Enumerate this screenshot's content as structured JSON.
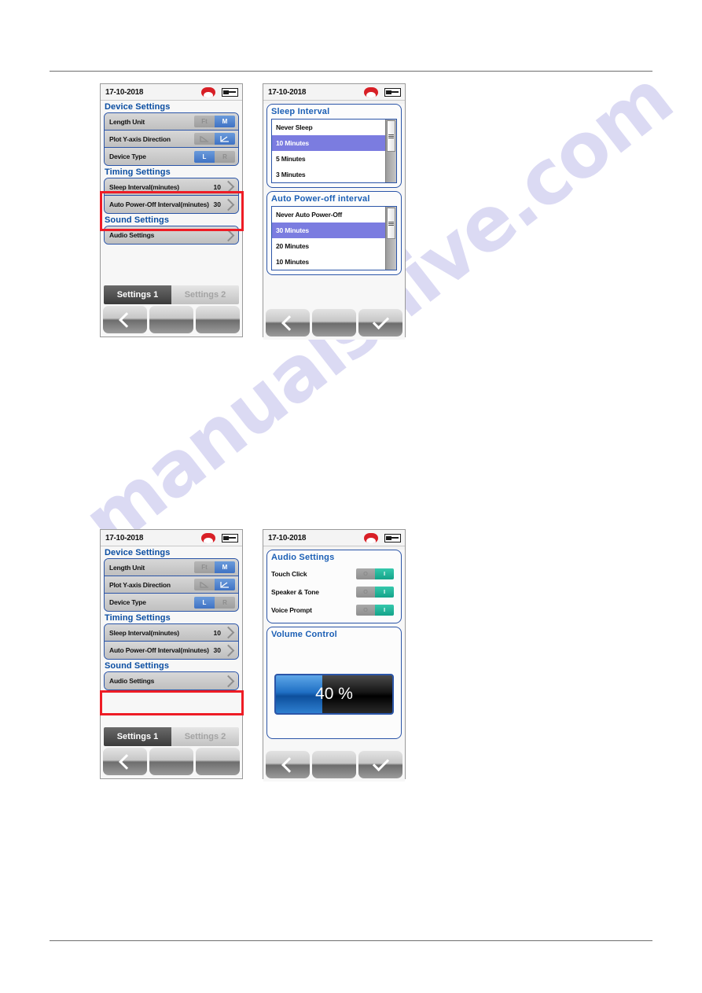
{
  "page": {
    "watermark_text": "manualshive.com"
  },
  "status_bar": {
    "date": "17-10-2018",
    "end_call_icon": "end-call-icon",
    "battery_icon": "battery-icon"
  },
  "screens": {
    "settings_list": {
      "sections": [
        {
          "title": "Device Settings",
          "rows": [
            {
              "label": "Length Unit",
              "type": "segmented",
              "options": [
                "Ft",
                "M"
              ],
              "selected_index": 1
            },
            {
              "label": "Plot Y-axis Direction",
              "type": "segmented",
              "options": [
                "down-plot-icon",
                "up-plot-icon"
              ],
              "selected_index": 1
            },
            {
              "label": "Device Type",
              "type": "segmented",
              "options": [
                "L",
                "R"
              ],
              "selected_index": 0
            }
          ]
        },
        {
          "title": "Timing Settings",
          "rows": [
            {
              "label": "Sleep Interval(minutes)",
              "type": "value",
              "value": "10"
            },
            {
              "label": "Auto Power-Off Interval(minutes)",
              "type": "value",
              "value": "30"
            }
          ]
        },
        {
          "title": "Sound Settings",
          "rows": [
            {
              "label": "Audio Settings",
              "type": "link",
              "value": ""
            }
          ]
        }
      ],
      "tabs": [
        {
          "label": "Settings 1",
          "active": true
        },
        {
          "label": "Settings 2",
          "active": false
        }
      ],
      "softkeys": [
        "back-arrow-icon",
        "",
        ""
      ]
    },
    "interval_picker": {
      "panels": [
        {
          "title": "Sleep Interval",
          "items": [
            {
              "label": "Never Sleep",
              "selected": false
            },
            {
              "label": "10 Minutes",
              "selected": true
            },
            {
              "label": "5 Minutes",
              "selected": false
            },
            {
              "label": "3 Minutes",
              "selected": false
            }
          ]
        },
        {
          "title": "Auto Power-off interval",
          "items": [
            {
              "label": "Never Auto Power-Off",
              "selected": false
            },
            {
              "label": "30 Minutes",
              "selected": true
            },
            {
              "label": "20 Minutes",
              "selected": false
            },
            {
              "label": "10 Minutes",
              "selected": false
            }
          ]
        }
      ],
      "softkeys": [
        "back-arrow-icon",
        "",
        "check-icon"
      ]
    },
    "audio_settings": {
      "panel_title": "Audio Settings",
      "rows": [
        {
          "label": "Touch Click",
          "off_label": "O",
          "on_label": "I",
          "state_on": true
        },
        {
          "label": "Speaker & Tone",
          "off_label": "O",
          "on_label": "I",
          "state_on": true
        },
        {
          "label": "Voice Prompt",
          "off_label": "O",
          "on_label": "I",
          "state_on": true
        }
      ],
      "volume": {
        "title": "Volume Control",
        "percent_label": "40 %",
        "percent_value": 40
      },
      "softkeys": [
        "back-arrow-icon",
        "",
        "check-icon"
      ]
    }
  },
  "colors": {
    "accent_blue": "#2b55a8",
    "heading_blue": "#0b4ea2",
    "selection_purple": "#7b7ce0",
    "toggle_on_teal": "#14a389",
    "highlight_red": "#ee1c25",
    "end_call_red": "#d81f26"
  }
}
